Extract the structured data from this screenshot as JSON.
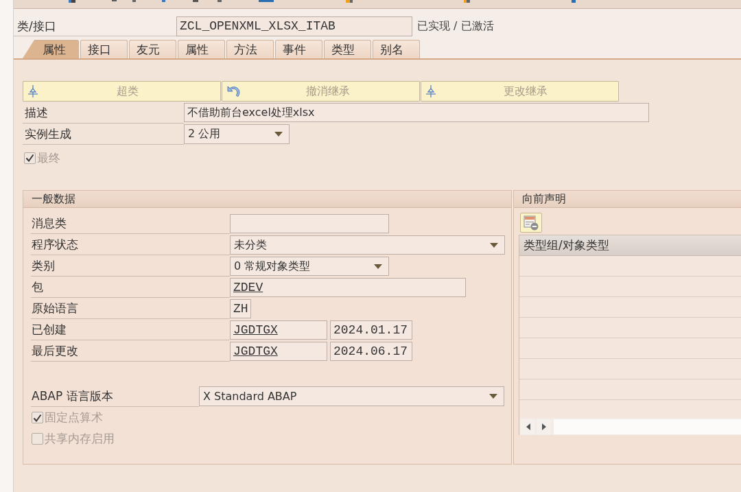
{
  "object": {
    "label": "类/接口",
    "name": "ZCL_OPENXML_XLSX_ITAB",
    "status": "已实现 / 已激活"
  },
  "tabs": [
    {
      "label": "属性",
      "selected": true
    },
    {
      "label": "接口",
      "selected": false
    },
    {
      "label": "友元",
      "selected": false
    },
    {
      "label": "属性",
      "selected": false
    },
    {
      "label": "方法",
      "selected": false
    },
    {
      "label": "事件",
      "selected": false
    },
    {
      "label": "类型",
      "selected": false
    },
    {
      "label": "别名",
      "selected": false
    }
  ],
  "actions": [
    {
      "label": "超类",
      "kind": "hierarchy",
      "disabled": true
    },
    {
      "label": "撤消继承",
      "kind": "undo",
      "disabled": true
    },
    {
      "label": "更改继承",
      "kind": "hierarchy",
      "disabled": true
    }
  ],
  "properties": [
    {
      "label": "描述",
      "kind": "text",
      "value": "不借助前台excel处理xlsx"
    },
    {
      "label": "实例生成",
      "kind": "dropdown",
      "value": "2 公用"
    }
  ],
  "final": {
    "label": "最终",
    "checked": true,
    "disabled": true
  },
  "general_data": {
    "title": "一般数据",
    "fields": [
      {
        "label": "消息类",
        "kind": "input"
      },
      {
        "label": "程序状态",
        "kind": "dropdown",
        "value": "未分类"
      },
      {
        "label": "类别",
        "kind": "dropdown",
        "value": "0 常规对象类型"
      },
      {
        "label": "包",
        "kind": "input",
        "value": "ZDEV",
        "link": true
      },
      {
        "label": "原始语言",
        "kind": "input",
        "value": "ZH",
        "link": false
      },
      {
        "label": "已创建",
        "kind": "user_date",
        "user": "JGDTGX",
        "date": "2024.01.17",
        "link": true
      },
      {
        "label": "最后更改",
        "kind": "user_date",
        "user": "JGDTGX",
        "date": "2024.06.17",
        "link": true
      }
    ],
    "language_version": {
      "label": "ABAP 语言版本",
      "value": "X Standard ABAP"
    },
    "options": [
      {
        "label": "固定点算术",
        "checked": true,
        "disabled": true
      },
      {
        "label": "共享内存启用",
        "checked": false,
        "disabled": true
      }
    ]
  },
  "forward_declarations": {
    "title": "向前声明",
    "table": {
      "columns": [
        "类型组/对象类型"
      ]
    }
  }
}
